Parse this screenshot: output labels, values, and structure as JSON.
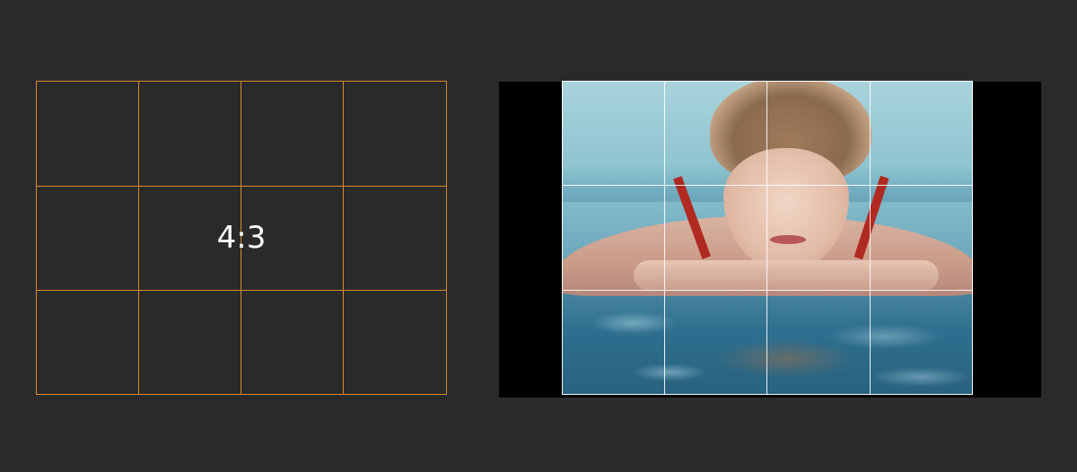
{
  "ratio_preset": {
    "label": "4:3",
    "accent_color": "#d88a2a",
    "grid": {
      "columns": 4,
      "rows": 3
    }
  },
  "preview": {
    "grid": {
      "columns": 4,
      "rows": 3
    },
    "letterbox_color": "#000000",
    "grid_color": "#ffffff"
  },
  "background_color": "#2a2a2a"
}
